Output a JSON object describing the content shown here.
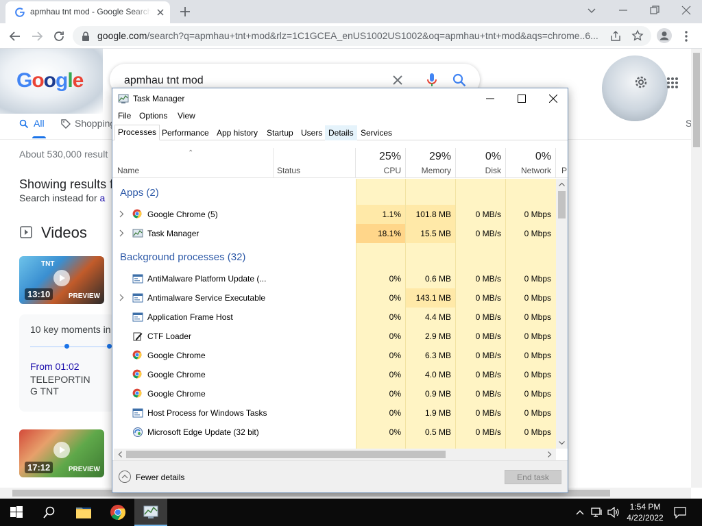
{
  "browser": {
    "tab_title": "apmhau tnt mod - Google Search",
    "url_host": "google.com",
    "url_path": "/search?q=apmhau+tnt+mod&rlz=1C1GCEA_enUS1002US1002&oq=apmhau+tnt+mod&aqs=chrome..6..."
  },
  "google": {
    "logo": "Google",
    "query": "apmhau tnt mod",
    "tabs": [
      "All",
      "Shopping"
    ],
    "stats": "About 530,000 result",
    "showing_prefix": "Showing results f",
    "instead_prefix": "Search instead for",
    "instead_link": "a",
    "videos_heading": "Videos",
    "video1_duration": "13:10",
    "video1_preview": "PREVIEW",
    "video1_title_top": "TNT",
    "key_moments": "10 key moments in",
    "from_time": "From 01:02",
    "moment_title_1": "TELEPORTIN",
    "moment_title_2": "G TNT",
    "video2_duration": "17:12",
    "video2_preview": "PREVIEW",
    "right_partial": "S"
  },
  "task_manager": {
    "title": "Task Manager",
    "menu": [
      "File",
      "Options",
      "View"
    ],
    "tabs": [
      "Processes",
      "Performance",
      "App history",
      "Startup",
      "Users",
      "Details",
      "Services"
    ],
    "columns": {
      "name": "Name",
      "status": "Status",
      "cpu_pct": "25%",
      "cpu": "CPU",
      "mem_pct": "29%",
      "mem": "Memory",
      "disk_pct": "0%",
      "disk": "Disk",
      "net_pct": "0%",
      "net": "Network",
      "partial": "P"
    },
    "apps_group": "Apps (2)",
    "apps": [
      {
        "name": "Google Chrome (5)",
        "cpu": "1.1%",
        "mem": "101.8 MB",
        "disk": "0 MB/s",
        "net": "0 Mbps",
        "icon": "chrome-icon",
        "expand": true
      },
      {
        "name": "Task Manager",
        "cpu": "18.1%",
        "mem": "15.5 MB",
        "disk": "0 MB/s",
        "net": "0 Mbps",
        "icon": "task-manager-icon",
        "expand": true
      }
    ],
    "bg_group": "Background processes (32)",
    "background": [
      {
        "name": "AntiMalware Platform Update (...",
        "cpu": "0%",
        "mem": "0.6 MB",
        "disk": "0 MB/s",
        "net": "0 Mbps",
        "icon": "window-app-icon",
        "expand": false
      },
      {
        "name": "Antimalware Service Executable",
        "cpu": "0%",
        "mem": "143.1 MB",
        "disk": "0 MB/s",
        "net": "0 Mbps",
        "icon": "window-app-icon",
        "expand": true
      },
      {
        "name": "Application Frame Host",
        "cpu": "0%",
        "mem": "4.4 MB",
        "disk": "0 MB/s",
        "net": "0 Mbps",
        "icon": "window-app-icon",
        "expand": false
      },
      {
        "name": "CTF Loader",
        "cpu": "0%",
        "mem": "2.9 MB",
        "disk": "0 MB/s",
        "net": "0 Mbps",
        "icon": "ctf-loader-icon",
        "expand": false
      },
      {
        "name": "Google Chrome",
        "cpu": "0%",
        "mem": "6.3 MB",
        "disk": "0 MB/s",
        "net": "0 Mbps",
        "icon": "chrome-icon",
        "expand": false
      },
      {
        "name": "Google Chrome",
        "cpu": "0%",
        "mem": "4.0 MB",
        "disk": "0 MB/s",
        "net": "0 Mbps",
        "icon": "chrome-icon",
        "expand": false
      },
      {
        "name": "Google Chrome",
        "cpu": "0%",
        "mem": "0.9 MB",
        "disk": "0 MB/s",
        "net": "0 Mbps",
        "icon": "chrome-icon",
        "expand": false
      },
      {
        "name": "Host Process for Windows Tasks",
        "cpu": "0%",
        "mem": "1.9 MB",
        "disk": "0 MB/s",
        "net": "0 Mbps",
        "icon": "window-app-icon",
        "expand": false
      },
      {
        "name": "Microsoft Edge Update (32 bit)",
        "cpu": "0%",
        "mem": "0.5 MB",
        "disk": "0 MB/s",
        "net": "0 Mbps",
        "icon": "edge-update-icon",
        "expand": false
      }
    ],
    "fewer_details": "Fewer details",
    "end_task": "End task"
  },
  "taskbar": {
    "time": "1:54 PM",
    "date": "4/22/2022"
  },
  "colors": {
    "heat_light": "#fff4c4",
    "heat_mid": "#ffe9a8",
    "heat_strong": "#ffd68a",
    "group_blue": "#2e5aa8",
    "chrome_tab_bg": "#dee1e6",
    "taskbar": "#0b0b0b"
  }
}
